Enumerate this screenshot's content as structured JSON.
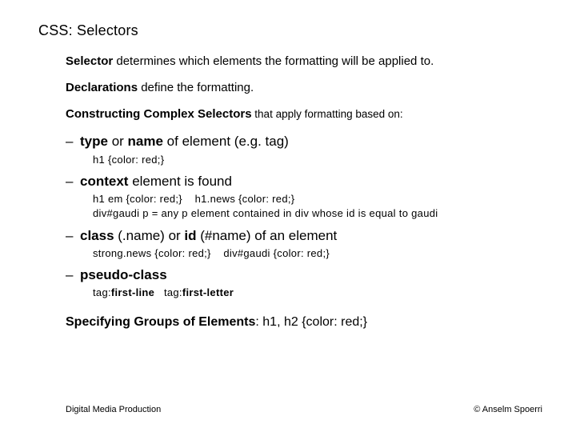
{
  "title": "CSS: Selectors",
  "p1_b": "Selector",
  "p1_t": " determines which elements the formatting will be applied to.",
  "p2_b": "Declarations",
  "p2_t": " define the formatting.",
  "p3_b": "Constructing Complex Selectors",
  "p3_t": " that apply formatting based on:",
  "b1_pre": "– ",
  "b1_b1": "type",
  "b1_mid": " or ",
  "b1_b2": "name",
  "b1_t": " of element (e.g. tag)",
  "b1_code": "h1 {color: red;}",
  "b2_pre": "– ",
  "b2_b": "context",
  "b2_t": " element is found",
  "b2_code1a": "h1 em {color: red;}",
  "b2_code1gap": "    ",
  "b2_code1b": "h1.news {color: red;}",
  "b2_code2": "div#gaudi p = any p element contained in div whose id is equal to gaudi",
  "b3_pre": "– ",
  "b3_b1": "class",
  "b3_mid1": " (.name) or ",
  "b3_b2": "id",
  "b3_t": " (#name) of an element",
  "b3_code_a": "strong.news {color: red;}",
  "b3_code_gap": "    ",
  "b3_code_b": "div#gaudi {color: red;}",
  "b4_pre": "– ",
  "b4_b": "pseudo-class",
  "b4_code_a": "tag:",
  "b4_code_ab": "first-line",
  "b4_code_gap": "   ",
  "b4_code_b": "tag:",
  "b4_code_bb": "first-letter",
  "p4_b": "Specifying Groups of Elements",
  "p4_t": ": h1, h2 {color: red;}",
  "footer_left": "Digital Media Production",
  "footer_right": "© Anselm Spoerri"
}
